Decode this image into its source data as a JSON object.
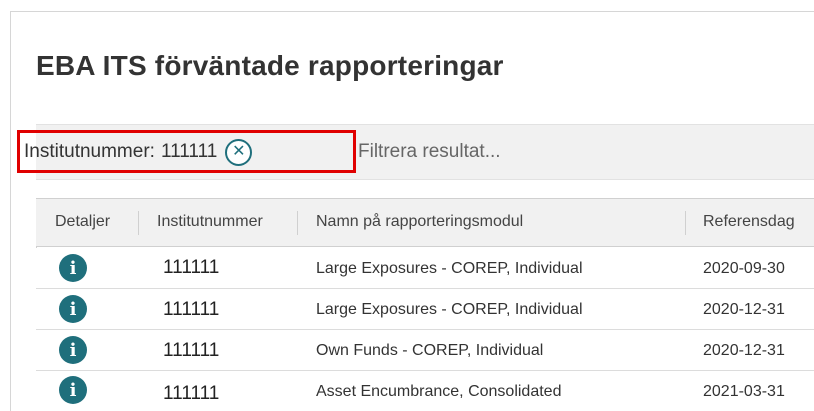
{
  "page": {
    "title": "EBA ITS förväntade rapporteringar"
  },
  "filter": {
    "chip_label": "Institutnummer:",
    "chip_value": "111111",
    "clear_icon": "close-circle-icon",
    "placeholder": "Filtrera resultat...",
    "highlight_color": "#e00000"
  },
  "table": {
    "columns": [
      "Detaljer",
      "Institutnummer",
      "Namn på rapporteringsmodul",
      "Referensdag"
    ],
    "rows": [
      {
        "detail_icon": "info-icon",
        "institutnummer": "111111",
        "modul": "Large Exposures - COREP, Individual",
        "referensdag": "2020-09-30"
      },
      {
        "detail_icon": "info-icon",
        "institutnummer": "111111",
        "modul": "Large Exposures - COREP, Individual",
        "referensdag": "2020-12-31"
      },
      {
        "detail_icon": "info-icon",
        "institutnummer": "111111",
        "modul": "Own Funds - COREP, Individual",
        "referensdag": "2020-12-31"
      },
      {
        "detail_icon": "info-icon",
        "institutnummer": "111111",
        "modul": "Asset Encumbrance, Consolidated",
        "referensdag": "2021-03-31"
      }
    ]
  },
  "colors": {
    "accent": "#1f6f7c",
    "header_bg": "#f1f1f1"
  }
}
